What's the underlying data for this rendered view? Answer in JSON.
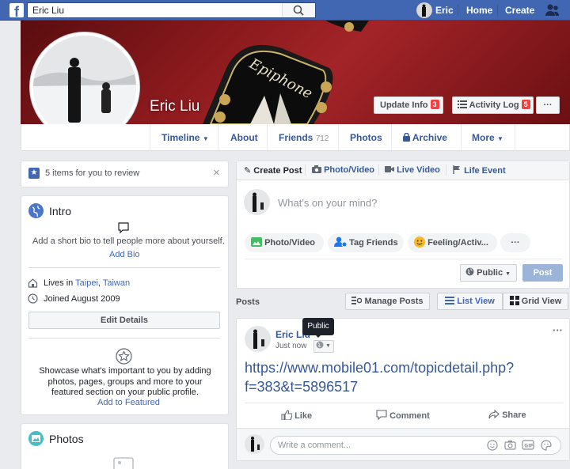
{
  "topbar": {
    "search_value": "Eric Liu",
    "user_name": "Eric",
    "home": "Home",
    "create": "Create"
  },
  "profile": {
    "name": "Eric Liu",
    "update_info": "Update Info",
    "update_info_count": "3",
    "activity_log": "Activity Log",
    "activity_log_count": "5",
    "more_dots": "···"
  },
  "nav": {
    "timeline": "Timeline",
    "about": "About",
    "friends": "Friends",
    "friends_count": "712",
    "photos": "Photos",
    "archive": "Archive",
    "more": "More"
  },
  "review": {
    "text": "5 items for you to review",
    "close": "×"
  },
  "intro": {
    "title": "Intro",
    "bio_prompt": "Add a short bio to tell people more about yourself.",
    "add_bio": "Add Bio",
    "lives_in_prefix": "Lives in",
    "city": "Taipei",
    "comma": ",",
    "country": "Taiwan",
    "joined": "Joined August 2009",
    "edit_details": "Edit Details",
    "showcase": "Showcase what's important to you by adding photos, pages, groups and more to your featured section on your public profile.",
    "add_featured": "Add to Featured"
  },
  "photos_card": {
    "title": "Photos"
  },
  "composer": {
    "tabs": [
      "Create Post",
      "Photo/Video",
      "Live Video",
      "Life Event"
    ],
    "placeholder": "What's on your mind?",
    "pills": [
      "Photo/Video",
      "Tag Friends",
      "Feeling/Activ..."
    ],
    "more": "···",
    "audience": "Public",
    "post": "Post"
  },
  "posts_bar": {
    "title": "Posts",
    "manage": "Manage Posts",
    "list_view": "List View",
    "grid_view": "Grid View"
  },
  "post": {
    "author": "Eric Liu",
    "time": "Just now",
    "tooltip": "Public",
    "more": "···",
    "link_line1": "https://www.mobile01.com/topicdetail.php?",
    "link_line2": "f=383&t=5896517",
    "like": "Like",
    "comment": "Comment",
    "share": "Share",
    "comment_placeholder": "Write a comment..."
  },
  "colors": {
    "brand": "#4267b2",
    "link": "#365899",
    "badge": "#fa3e3e"
  }
}
